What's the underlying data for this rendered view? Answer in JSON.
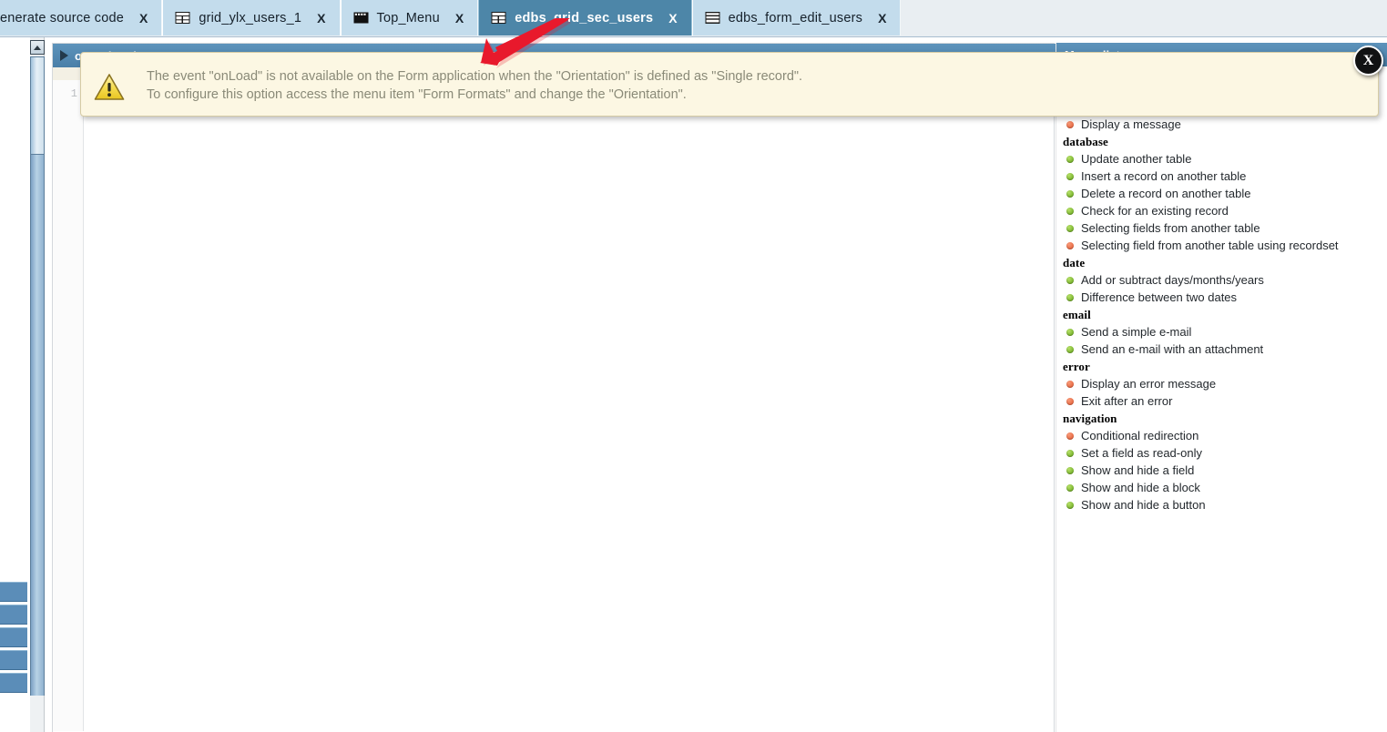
{
  "tabs": [
    {
      "label": "enerate source code",
      "icon": "none",
      "close": "X",
      "active": false,
      "clipped": true
    },
    {
      "label": "grid_ylx_users_1",
      "icon": "grid-icon",
      "close": "X",
      "active": false,
      "clipped": false
    },
    {
      "label": "Top_Menu",
      "icon": "menu-icon",
      "close": "X",
      "active": false,
      "clipped": false
    },
    {
      "label": "edbs_grid_sec_users",
      "icon": "grid-icon",
      "close": "X",
      "active": true,
      "clipped": false
    },
    {
      "label": "edbs_form_edit_users",
      "icon": "form-icon",
      "close": "X",
      "active": false,
      "clipped": false
    }
  ],
  "editor": {
    "header_title": "onScriptInit",
    "line_number": "1"
  },
  "right_panel": {
    "header_title": "Macro list"
  },
  "warning": {
    "line1": "The event \"onLoad\" is not available on the Form application when the \"Orientation\" is defined as \"Single record\".",
    "line2": "To configure this option access the menu item \"Form Formats\" and change the \"Orientation\"."
  },
  "close_badge": {
    "label": "X"
  },
  "macro_groups": [
    {
      "title": "",
      "items": [
        {
          "label": "Display a message",
          "status": "red"
        }
      ]
    },
    {
      "title": "database",
      "items": [
        {
          "label": "Update another table",
          "status": "green"
        },
        {
          "label": "Insert a record on another table",
          "status": "green"
        },
        {
          "label": "Delete a record on another table",
          "status": "green"
        },
        {
          "label": "Check for an existing record",
          "status": "green"
        },
        {
          "label": "Selecting fields from another table",
          "status": "green"
        },
        {
          "label": "Selecting field from another table using recordset",
          "status": "red"
        }
      ]
    },
    {
      "title": "date",
      "items": [
        {
          "label": "Add or subtract days/months/years",
          "status": "green"
        },
        {
          "label": "Difference between two dates",
          "status": "green"
        }
      ]
    },
    {
      "title": "email",
      "items": [
        {
          "label": "Send a simple e-mail",
          "status": "green"
        },
        {
          "label": "Send an e-mail with an attachment",
          "status": "green"
        }
      ]
    },
    {
      "title": "error",
      "items": [
        {
          "label": "Display an error message",
          "status": "red"
        },
        {
          "label": "Exit after an error",
          "status": "red"
        }
      ]
    },
    {
      "title": "navigation",
      "items": [
        {
          "label": "Conditional redirection",
          "status": "red"
        },
        {
          "label": "Set a field as read-only",
          "status": "green"
        },
        {
          "label": "Show and hide a field",
          "status": "green"
        },
        {
          "label": "Show and hide a block",
          "status": "green"
        },
        {
          "label": "Show and hide a button",
          "status": "green"
        }
      ]
    }
  ],
  "side_blocks": {
    "count": 5
  },
  "colors": {
    "accent_blue": "#4d86a8",
    "tab_bg": "#c3dcec",
    "warning_bg": "#fcf7e3",
    "warning_border": "#d6cba4",
    "status_green": "#5da011",
    "status_red": "#e2542b",
    "arrow_red": "#e8192c"
  }
}
